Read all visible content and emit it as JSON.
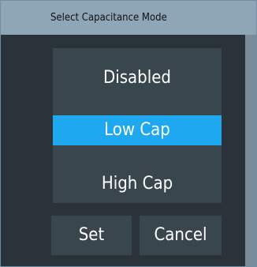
{
  "dialog": {
    "title": "Select Capacitance Mode",
    "options": [
      {
        "label": "Disabled",
        "selected": false
      },
      {
        "label": "Low Cap",
        "selected": true
      },
      {
        "label": "High Cap",
        "selected": false
      }
    ],
    "buttons": {
      "set_label": "Set",
      "cancel_label": "Cancel"
    }
  },
  "colors": {
    "title_bar": "#8ea6b6",
    "background": "#2a3339",
    "panel": "#3a464e",
    "selected": "#1ea8f0",
    "text": "#ffffff"
  }
}
